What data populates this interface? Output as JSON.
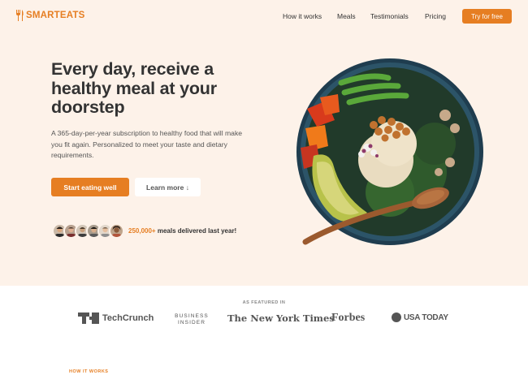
{
  "brand": {
    "name": "SMARTEATS",
    "logo_icon": "fork-knife-icon",
    "accent": "#e67e22",
    "hero_bg": "#fdf2e9"
  },
  "nav": {
    "items": [
      "How it works",
      "Meals",
      "Testimonials",
      "Pricing"
    ],
    "cta": "Try for free"
  },
  "hero": {
    "headline": "Every day, receive a healthy meal at your doorstep",
    "description": "A 365-day-per-year subscription to healthy food that will make you fit again. Personalized to meet your taste and dietary requirements.",
    "primary_button": "Start eating well",
    "secondary_button": "Learn more ↓",
    "delivered_count": "250,000+",
    "delivered_text": "meals delivered last year!",
    "customer_avatar_count": 6
  },
  "featured": {
    "label": "AS FEATURED IN",
    "logos": [
      "TechCrunch",
      "BUSINESS INSIDER",
      "The New York Times",
      "Forbes",
      "USA TODAY"
    ]
  },
  "next_section": {
    "label": "HOW IT WORKS"
  }
}
